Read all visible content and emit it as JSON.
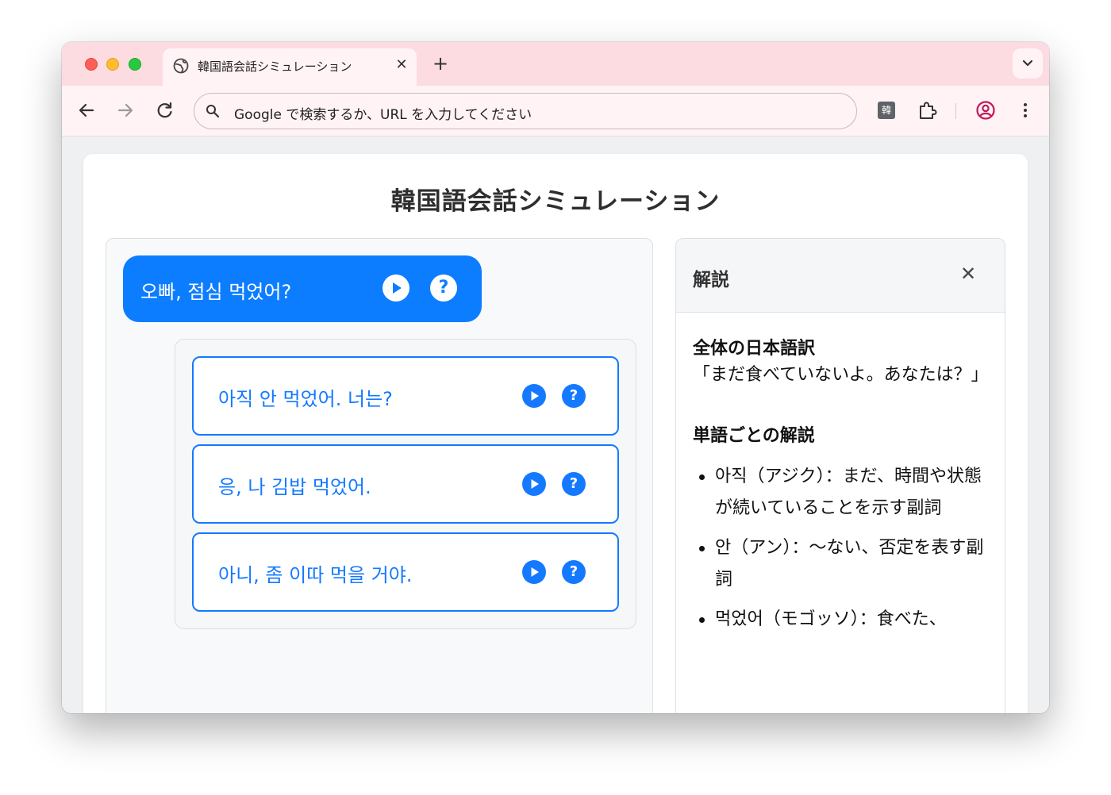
{
  "browser": {
    "tab_title": "韓国語会話シミュレーション",
    "tab_close": "✕",
    "new_tab": "+",
    "omnibox_placeholder": "Google で検索するか、URL を入力してください",
    "extension_badge": "韓"
  },
  "app": {
    "title": "韓国語会話シミュレーション",
    "prompt": {
      "text": "오빠, 점심 먹었어?",
      "help": "?"
    },
    "options": [
      {
        "text": "아직 안 먹었어. 너는?",
        "help": "?"
      },
      {
        "text": "응, 나 김밥 먹었어.",
        "help": "?"
      },
      {
        "text": "아니, 좀 이따 먹을 거야.",
        "help": "?"
      }
    ]
  },
  "panel": {
    "title": "解説",
    "close": "✕",
    "translation_heading": "全体の日本語訳",
    "translation_text": "「まだ食べていないよ。あなたは？」",
    "words_heading": "単語ごとの解説",
    "words": [
      "아직（アジク）：まだ、時間や状態が続いていることを示す副詞",
      "안（アン）：〜ない、否定を表す副詞",
      "먹었어（モゴッソ）：食べた、"
    ]
  },
  "colors": {
    "tabbar": "#fcdbe1",
    "accent_blue": "#1479ff",
    "prompt_blue": "#0d7dff"
  }
}
